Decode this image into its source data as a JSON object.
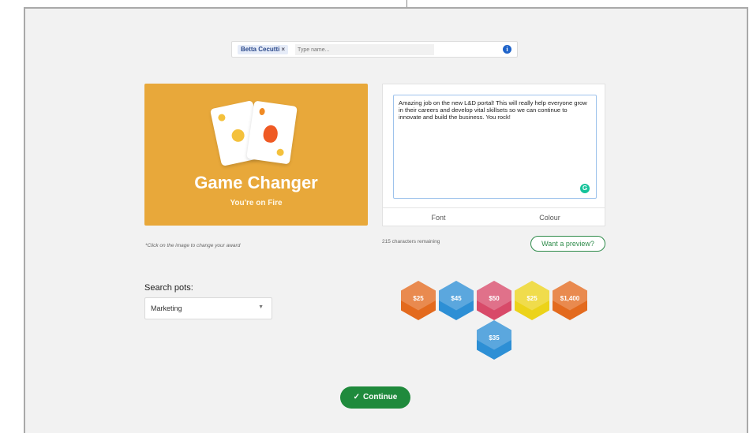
{
  "recipient": {
    "chip_label": "Betta Cecutti",
    "chip_remove": "×",
    "input_placeholder": "Type name...",
    "info_icon": "info-icon"
  },
  "award": {
    "title": "Game Changer",
    "subtitle": "You're on Fire",
    "background_color": "#e8a83a",
    "hint": "*Click on the image to change your award"
  },
  "message": {
    "text": "Amazing job on the new L&D portal! This will really help everyone grow in their careers and develop vital skillsets so we can continue to innovate and build the business. You rock!",
    "chars_remaining": "215 characters remaining",
    "tabs": [
      "Font",
      "Colour"
    ],
    "preview_label": "Want a preview?"
  },
  "pots": {
    "label": "Search pots:",
    "selected": "Marketing"
  },
  "amounts": [
    {
      "label": "$25",
      "color": "#e36a1e"
    },
    {
      "label": "$45",
      "color": "#2d8fd5"
    },
    {
      "label": "$50",
      "color": "#d84a69"
    },
    {
      "label": "$25",
      "color": "#ecd31a"
    },
    {
      "label": "$1,400",
      "color": "#e36a1e"
    },
    {
      "label": "$35",
      "color": "#2d8fd5"
    }
  ],
  "continue_label": "Continue",
  "continue_color": "#1f8a3c"
}
